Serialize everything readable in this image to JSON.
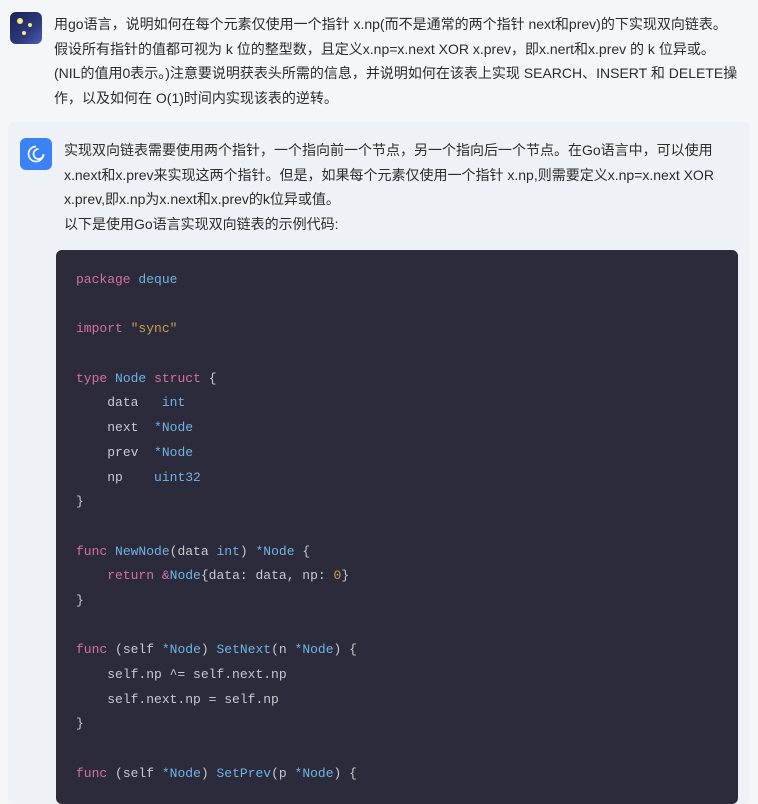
{
  "conversation": {
    "user_message": "用go语言，说明如何在每个元素仅使用一个指针 x.np(而不是通常的两个指针 next和prev)的下实现双向链表。假设所有指针的值都可视为 k 位的整型数，且定义x.np=x.next XOR x.prev，即x.nert和x.prev 的 k 位异或。(NIL的值用0表示。)注意要说明获表头所需的信息，并说明如何在该表上实现 SEARCH、INSERT 和 DELETE操作，以及如何在 O(1)时间内实现该表的逆转。",
    "assistant_message_p1": "实现双向链表需要使用两个指针，一个指向前一个节点，另一个指向后一个节点。在Go语言中，可以使用x.next和x.prev来实现这两个指针。但是，如果每个元素仅使用一个指针 x.np,则需要定义x.np=x.next XOR x.prev,即x.np为x.next和x.prev的k位异或值。",
    "assistant_message_p2": "以下是使用Go语言实现双向链表的示例代码:"
  },
  "code": {
    "kw_package": "package",
    "pkg_name": "deque",
    "kw_import": "import",
    "import_value": "\"sync\"",
    "kw_type": "type",
    "type_name": "Node",
    "kw_struct": "struct",
    "field_data": "data",
    "field_data_type": "int",
    "field_next": "next",
    "field_next_type": "*Node",
    "field_prev": "prev",
    "field_prev_type": "*Node",
    "field_np": "np",
    "field_np_type": "uint32",
    "kw_func": "func",
    "fn_newnode": "NewNode",
    "newnode_params": "(data",
    "newnode_param_type": "int",
    "newnode_ret": "*Node",
    "kw_return": "return",
    "newnode_body_amp": "&",
    "newnode_body_node": "Node",
    "newnode_body_brace": "{data: data, np:",
    "newnode_body_zero": "0",
    "newnode_body_close": "}",
    "fn_setnext": "SetNext",
    "recv_open": "(self",
    "recv_type": "*Node",
    "recv_close": ")",
    "setnext_params": "(n",
    "setnext_param_type": "*Node",
    "setnext_line1": "self.np ^= self.next.np",
    "setnext_line2": "self.next.np = self.np",
    "fn_setprev": "SetPrev",
    "setprev_params": "(p",
    "setprev_param_type": "*Node",
    "brace_open": "{",
    "brace_close": "}",
    "paren_close_brace": ") {"
  }
}
